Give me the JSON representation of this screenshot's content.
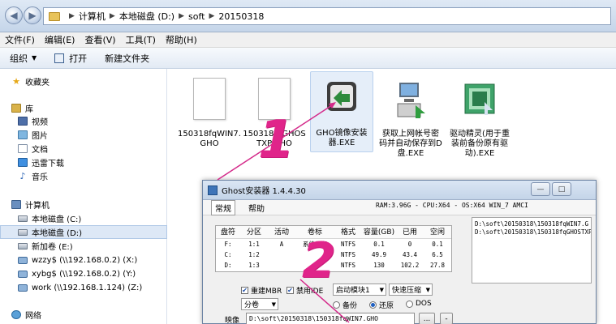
{
  "address_bar": {
    "breadcrumbs": [
      "计算机",
      "本地磁盘 (D:)",
      "soft",
      "20150318"
    ]
  },
  "menu": [
    "文件(F)",
    "编辑(E)",
    "查看(V)",
    "工具(T)",
    "帮助(H)"
  ],
  "toolbar": {
    "organize": "组织",
    "open": "打开",
    "new_folder": "新建文件夹"
  },
  "nav": {
    "favorites": "收藏夹",
    "libraries": "库",
    "library_items": [
      "视频",
      "图片",
      "文档",
      "迅雷下载",
      "音乐"
    ],
    "computer": "计算机",
    "drives": [
      "本地磁盘 (C:)",
      "本地磁盘 (D:)",
      "新加卷 (E:)",
      "wzzy$ (\\\\192.168.0.2) (X:)",
      "xybg$ (\\\\192.168.0.2) (Y:)",
      "work (\\\\192.168.1.124) (Z:)"
    ],
    "network": "网络"
  },
  "files": [
    {
      "name": "150318fqWIN7.GHO"
    },
    {
      "name": "150318fqGHOSTXP.GHO"
    },
    {
      "name": "GHO镜像安装器.EXE"
    },
    {
      "name": "获取上网帐号密码并自动保存到D盘.EXE"
    },
    {
      "name": "驱动精灵(用于重装前备份原有驱动).EXE"
    }
  ],
  "ghost": {
    "title": "Ghost安装器 1.4.4.30",
    "tabs": [
      "常规",
      "帮助"
    ],
    "sysinfo": "RAM:3.96G - CPU:X64 - OS:X64 WIN_7 AMCI",
    "columns": [
      "盘符",
      "分区",
      "活动",
      "卷标",
      "格式",
      "容量(GB)",
      "已用",
      "空闲"
    ],
    "rows": [
      [
        "F:",
        "1:1",
        "A",
        "系统保留",
        "NTFS",
        "0.1",
        "0",
        "0.1"
      ],
      [
        "C:",
        "1:2",
        "",
        "",
        "NTFS",
        "49.9",
        "43.4",
        "6.5"
      ],
      [
        "D:",
        "1:3",
        "",
        "",
        "NTFS",
        "130",
        "102.2",
        "27.8"
      ]
    ],
    "list_items": [
      "D:\\soft\\20150318\\150318fqWIN7.G",
      "D:\\soft\\20150318\\150318fqGHOSTXP."
    ],
    "opt_reboot": "重建MBR",
    "opt_ide": "禁用IDE",
    "opt_boot": "启动模块1",
    "opt_compress": "快速压缩",
    "opt_split": "分卷",
    "radio_backup": "备份",
    "radio_restore": "还原",
    "radio_dos": "DOS",
    "image_label": "映像",
    "image_path": "D:\\soft\\20150318\\150318fqWIN7.GHO",
    "btn_browse": "...",
    "btn_minus": "-"
  },
  "annotations": {
    "one": "1",
    "two": "2"
  }
}
